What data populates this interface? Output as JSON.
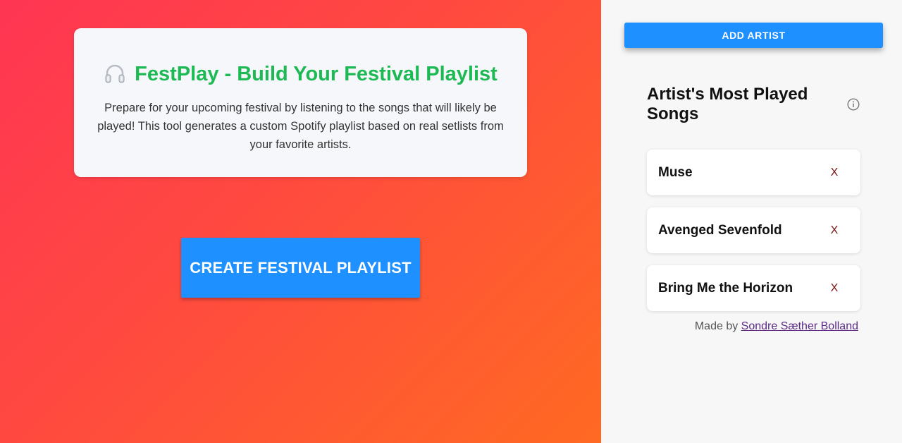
{
  "intro": {
    "icon": "headphones-icon",
    "title": "FestPlay - Build Your Festival Playlist",
    "description": "Prepare for your upcoming festival by listening to the songs that will likely be played! This tool generates a custom Spotify playlist based on real setlists from your favorite artists.",
    "title_color": "#1db954"
  },
  "create_button_label": "CREATE FESTIVAL PLAYLIST",
  "sidebar": {
    "add_button_label": "ADD ARTIST",
    "section_title": "Artist's Most Played Songs",
    "info_icon": "info-icon",
    "artists": [
      {
        "name": "Muse",
        "remove_label": "X"
      },
      {
        "name": "Avenged Sevenfold",
        "remove_label": "X"
      },
      {
        "name": "Bring Me the Horizon",
        "remove_label": "X"
      }
    ],
    "footer_prefix": "Made by",
    "footer_link": "Sondre Sæther Bolland"
  },
  "colors": {
    "accent": "#1e90ff",
    "gradient_start": "#ff3553",
    "gradient_end": "#ff6a22"
  }
}
